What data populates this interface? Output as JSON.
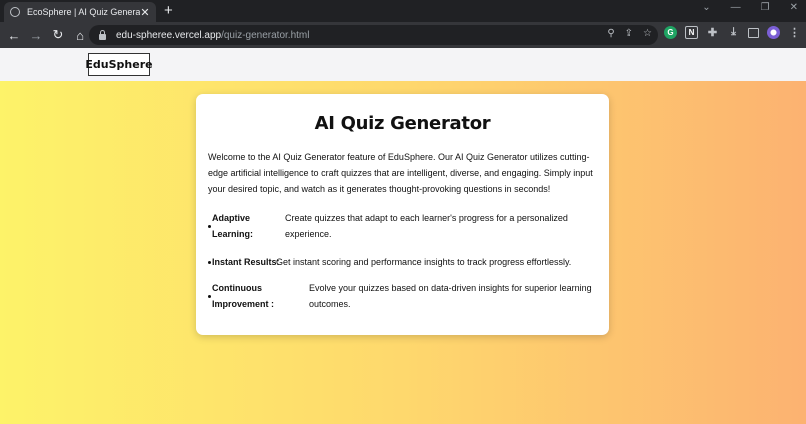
{
  "browser": {
    "tab_title": "EcoSphere | AI Quiz Generator",
    "tab_close": "✕",
    "new_tab": "+",
    "url_host": "edu-spheree.vercel.app",
    "url_path": "/quiz-generator.html",
    "window_controls": [
      "⌄",
      "—",
      "❐",
      "✕"
    ]
  },
  "site": {
    "logo": "EduSphere"
  },
  "card": {
    "title": "AI Quiz Generator",
    "intro": "Welcome to the AI Quiz Generator feature of EduSphere. Our AI Quiz Generator utilizes cutting-edge artificial intelligence to craft quizzes that are intelligent, diverse, and engaging. Simply input your desired topic, and watch as it generates thought-provoking questions in seconds!",
    "features": [
      {
        "label_line1": "Adaptive",
        "label_line2": "Learning:",
        "desc_line1": "Create quizzes that adapt to each learner's progress for a personalized",
        "desc_line2": "experience."
      },
      {
        "label": "Instant Results:",
        "desc": "Get instant scoring and performance insights to track progress effortlessly."
      },
      {
        "label_line1": "Continuous",
        "label_line2": "Improvement :",
        "desc_line1": "Evolve your quizzes based on data-driven insights for superior learning",
        "desc_line2": "outcomes."
      }
    ]
  },
  "colors": {
    "gradient_start": "#fdf369",
    "gradient_end": "#fcb271",
    "card_bg": "#ffffff"
  }
}
